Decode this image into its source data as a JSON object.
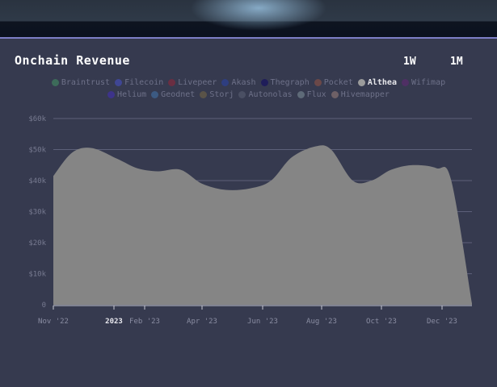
{
  "header": {
    "title": "Onchain Revenue",
    "range_buttons": [
      "1W",
      "1M"
    ]
  },
  "legend": [
    {
      "name": "Braintrust",
      "color": "#3d6b5a",
      "active": false
    },
    {
      "name": "Filecoin",
      "color": "#3f4694",
      "active": false
    },
    {
      "name": "Livepeer",
      "color": "#6a2e42",
      "active": false
    },
    {
      "name": "Akash",
      "color": "#2e3e80",
      "active": false
    },
    {
      "name": "Thegraph",
      "color": "#1f1d5a",
      "active": false
    },
    {
      "name": "Pocket",
      "color": "#6b4848",
      "active": false
    },
    {
      "name": "Althea",
      "color": "#9b9b9b",
      "active": true
    },
    {
      "name": "Wifimap",
      "color": "#4f2f64",
      "active": false
    },
    {
      "name": "Helium",
      "color": "#3d338a",
      "active": false
    },
    {
      "name": "Geodnet",
      "color": "#3c5a82",
      "active": false
    },
    {
      "name": "Storj",
      "color": "#5a5348",
      "active": false
    },
    {
      "name": "Autonolas",
      "color": "#4a4f63",
      "active": false
    },
    {
      "name": "Flux",
      "color": "#5e6a78",
      "active": false
    },
    {
      "name": "Hivemapper",
      "color": "#6e6066",
      "active": false
    }
  ],
  "chart_data": {
    "type": "area",
    "y_ticks": [
      "0",
      "$10k",
      "$20k",
      "$30k",
      "$40k",
      "$50k",
      "$60k"
    ],
    "ylim": [
      0,
      60000
    ],
    "x_ticks": [
      {
        "label": "Nov '22",
        "bold": false
      },
      {
        "label": "2023",
        "bold": true
      },
      {
        "label": "Feb '23",
        "bold": false
      },
      {
        "label": "Apr '23",
        "bold": false
      },
      {
        "label": "Jun '23",
        "bold": false
      },
      {
        "label": "Aug '23",
        "bold": false
      },
      {
        "label": "Oct '23",
        "bold": false
      },
      {
        "label": "Dec '23",
        "bold": false
      }
    ],
    "grid": true,
    "series": [
      {
        "name": "Althea",
        "color": "#858585",
        "x": [
          "2022-11-01",
          "2022-11-20",
          "2022-12-10",
          "2023-01-05",
          "2023-01-25",
          "2023-02-15",
          "2023-03-10",
          "2023-04-01",
          "2023-04-25",
          "2023-05-20",
          "2023-06-10",
          "2023-07-01",
          "2023-07-25",
          "2023-08-10",
          "2023-09-01",
          "2023-09-20",
          "2023-10-10",
          "2023-11-01",
          "2023-11-25",
          "2023-12-10",
          "2023-12-31"
        ],
        "values": [
          41500,
          49000,
          50500,
          47000,
          44000,
          43000,
          43500,
          39000,
          37000,
          37500,
          40000,
          47500,
          51000,
          50000,
          40000,
          40000,
          43500,
          45000,
          44000,
          40000,
          500
        ]
      }
    ]
  }
}
